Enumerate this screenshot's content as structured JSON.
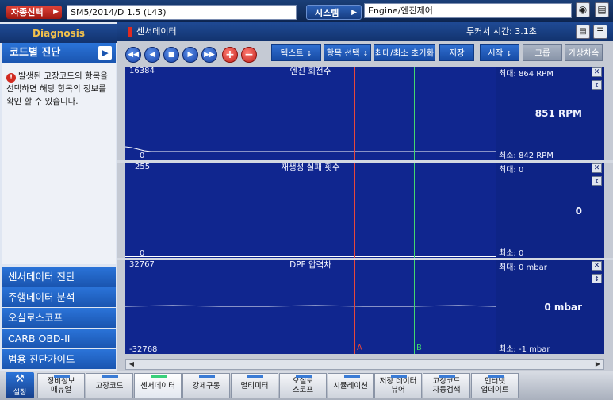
{
  "topbar": {
    "car_select_label": "자종선택",
    "car_value": "SM5/2014/D 1.5 (L43)",
    "system_label": "시스템",
    "system_value": "Engine/엔진제어",
    "icons": [
      "camera-icon",
      "print-icon",
      "minimize-icon"
    ]
  },
  "sidebar": {
    "diagnosis_title": "Diagnosis",
    "code_diag_label": "코드별 진단",
    "info_text": "발생된 고장코드의 항목을 선택하면 해당 항목의 정보를 확인 할 수 있습니다.",
    "menu": [
      {
        "label": "센서데이터 진단"
      },
      {
        "label": "주행데이터 분석"
      },
      {
        "label": "오실로스코프"
      },
      {
        "label": "CARB OBD-II"
      },
      {
        "label": "범용 진단가이드"
      }
    ]
  },
  "main": {
    "title": "센서데이터",
    "timer_label": "투커서 시간: 3.1초",
    "toolbar": {
      "text_select": "텍스트",
      "item_select": "항목 선택",
      "reset_minmax": "최대/최소 초기화",
      "save": "저장",
      "start": "시작",
      "group": "그룹",
      "virtual": "가상차속"
    },
    "graphs": [
      {
        "title": "엔진 회전수",
        "max_axis": "16384",
        "min_axis": "0",
        "max_label": "최대:",
        "max_value": "864 RPM",
        "current": "851 RPM",
        "min_label": "최소:",
        "min_value": "842 RPM"
      },
      {
        "title": "재생성 실패 횟수",
        "max_axis": "255",
        "min_axis": "0",
        "max_label": "최대:",
        "max_value": "0",
        "current": "0",
        "min_label": "최소:",
        "min_value": "0"
      },
      {
        "title": "DPF 압력차",
        "max_axis": "32767",
        "min_axis": "-32768",
        "max_label": "최대:",
        "max_value": "0 mbar",
        "current": "0 mbar",
        "min_label": "최소:",
        "min_value": "-1 mbar"
      }
    ],
    "cursor_a_label": "A",
    "cursor_b_label": "B"
  },
  "bottombar": {
    "settings_label": "설정",
    "tabs": [
      {
        "label": "정비정보\n매뉴얼"
      },
      {
        "label": "고장코드"
      },
      {
        "label": "센서데이터"
      },
      {
        "label": "강제구동"
      },
      {
        "label": "멀티미터"
      },
      {
        "label": "오실로\n스코프"
      },
      {
        "label": "시뮬레이션"
      },
      {
        "label": "저장 데이터\n뷰어"
      },
      {
        "label": "고장코드\n자동검색"
      },
      {
        "label": "인터넷\n업데이트"
      }
    ]
  },
  "colors": {
    "graph_bg": "#10268f",
    "accent_red": "#e02a20",
    "cursor_a": "#e7473b",
    "cursor_b": "#40d870",
    "menu_blue": "#1a55b0"
  }
}
